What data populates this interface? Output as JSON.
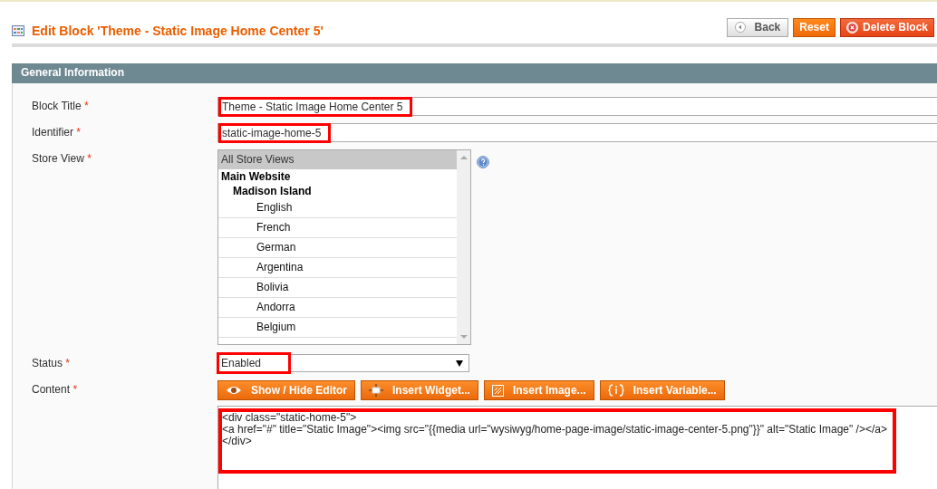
{
  "page": {
    "title": "Edit Block 'Theme - Static Image Home Center 5'"
  },
  "actions": [
    {
      "label": "Back",
      "kind": "back"
    },
    {
      "label": "Reset",
      "kind": "reset"
    },
    {
      "label": "Delete Block",
      "kind": "delete"
    }
  ],
  "section": {
    "title": "General Information"
  },
  "fields": {
    "block_title": {
      "label": "Block Title",
      "required_mark": "*",
      "value": "Theme - Static Image Home Center 5",
      "highlighted": true
    },
    "identifier": {
      "label": "Identifier",
      "required_mark": "*",
      "value": "static-image-home-5",
      "highlighted": true
    },
    "store_view": {
      "label": "Store View",
      "required_mark": "*",
      "options": [
        {
          "label": "All Store Views",
          "kind": "option",
          "selected": true
        },
        {
          "label": "Main Website",
          "kind": "group",
          "children": [
            {
              "label": "Madison Island",
              "kind": "group",
              "children": [
                {
                  "label": "English",
                  "kind": "option",
                  "selected": false
                },
                {
                  "label": "French",
                  "kind": "option",
                  "selected": false
                },
                {
                  "label": "German",
                  "kind": "option",
                  "selected": false
                },
                {
                  "label": "Argentina",
                  "kind": "option",
                  "selected": false
                },
                {
                  "label": "Bolivia",
                  "kind": "option",
                  "selected": false
                },
                {
                  "label": "Andorra",
                  "kind": "option",
                  "selected": false
                },
                {
                  "label": "Belgium",
                  "kind": "option",
                  "selected": false
                }
              ]
            }
          ]
        }
      ]
    },
    "status": {
      "label": "Status",
      "required_mark": "*",
      "value": "Enabled",
      "highlighted": true
    },
    "content": {
      "label": "Content",
      "required_mark": "*",
      "highlighted": true,
      "toolbar": [
        {
          "label": "Show / Hide Editor",
          "kind": "eye"
        },
        {
          "label": "Insert Widget...",
          "kind": "widget"
        },
        {
          "label": "Insert Image...",
          "kind": "image"
        },
        {
          "label": "Insert Variable...",
          "kind": "variable"
        }
      ],
      "lines": [
        "<div class=\"static-home-5\">",
        "<a href=\"#\" title=\"Static Image\"><img src=\"{{media url=\"wysiwyg/home-page-image/static-image-center-5.png\"}}\" alt=\"Static Image\" /></a>",
        "</div>"
      ]
    }
  }
}
